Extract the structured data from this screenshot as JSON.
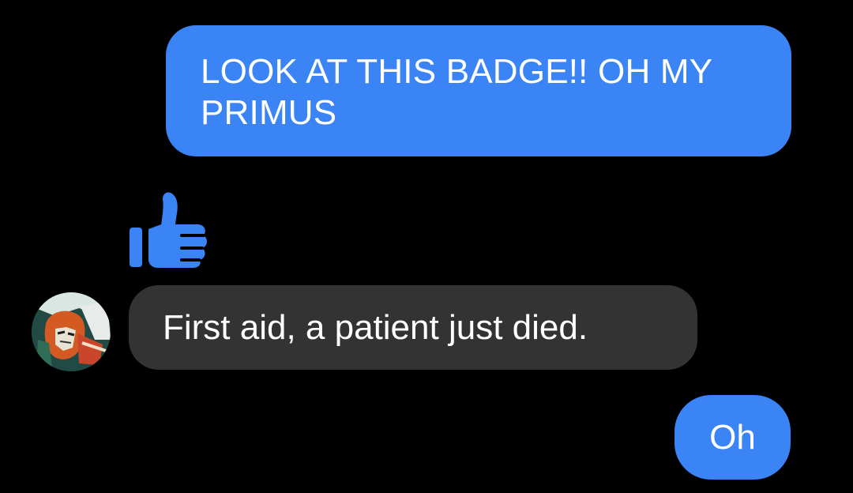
{
  "messages": [
    {
      "direction": "outgoing",
      "text": "LOOK AT THIS BADGE!! OH MY PRIMUS"
    },
    {
      "direction": "incoming",
      "text": "First aid, a patient just died."
    },
    {
      "direction": "outgoing",
      "text": "Oh"
    }
  ],
  "sent_reaction_icon": "thumbs-up-icon",
  "colors": {
    "background": "#000000",
    "outgoing_bubble": "#3b84f5",
    "incoming_bubble": "#333333",
    "text": "#ffffff",
    "thumb": "#3b84f5"
  }
}
